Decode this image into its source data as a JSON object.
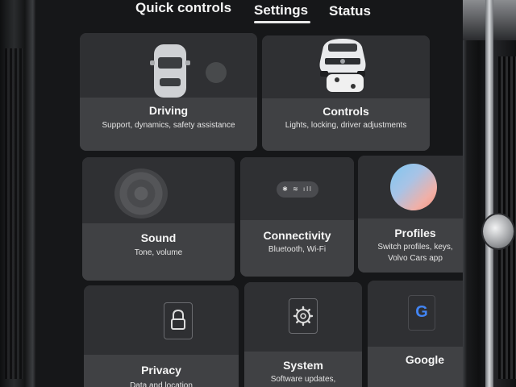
{
  "tabs": {
    "quick_controls": "Quick controls",
    "settings": "Settings",
    "status": "Status",
    "active": "Settings"
  },
  "cards": {
    "driving": {
      "title": "Driving",
      "subtitle": "Support, dynamics, safety assistance",
      "icon": "car-top-view-icon"
    },
    "controls": {
      "title": "Controls",
      "subtitle": "Lights, locking, driver adjustments",
      "icon": "suv-front-icon"
    },
    "sound": {
      "title": "Sound",
      "subtitle": "Tone, volume",
      "icon": "speaker-disc-icon"
    },
    "connectivity": {
      "title": "Connectivity",
      "subtitle": "Bluetooth, Wi-Fi",
      "icon": "connectivity-status-icon"
    },
    "profiles": {
      "title": "Profiles",
      "subtitle_line1": "Switch profiles, keys,",
      "subtitle_line2": "Volvo Cars app",
      "icon": "profile-orb-icon"
    },
    "privacy": {
      "title": "Privacy",
      "subtitle": "Data and location",
      "icon": "lock-icon"
    },
    "system": {
      "title": "System",
      "subtitle": "Software updates,",
      "icon": "gear-icon"
    },
    "google": {
      "title": "Google",
      "icon": "google-logo-icon"
    }
  },
  "colors": {
    "card_top": "#2f3033",
    "card_bottom": "#404144",
    "screen_bg": "#161719"
  }
}
